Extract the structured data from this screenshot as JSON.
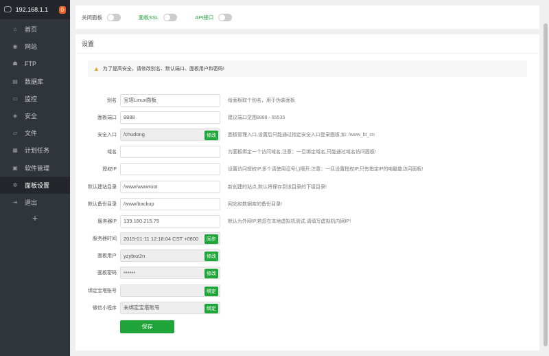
{
  "sidebar": {
    "host": "192.168.1.1",
    "badge": "0",
    "items": [
      {
        "label": "首页",
        "icon": "home-icon",
        "glyph": "⌂"
      },
      {
        "label": "网站",
        "icon": "globe-icon",
        "glyph": "◉"
      },
      {
        "label": "FTP",
        "icon": "ftp-icon",
        "glyph": "☗"
      },
      {
        "label": "数据库",
        "icon": "database-icon",
        "glyph": "▤"
      },
      {
        "label": "监控",
        "icon": "monitor-icon",
        "glyph": "▭"
      },
      {
        "label": "安全",
        "icon": "shield-icon",
        "glyph": "◈"
      },
      {
        "label": "文件",
        "icon": "folder-icon",
        "glyph": "▱"
      },
      {
        "label": "计划任务",
        "icon": "calendar-icon",
        "glyph": "▦"
      },
      {
        "label": "软件管理",
        "icon": "apps-icon",
        "glyph": "▣"
      },
      {
        "label": "面板设置",
        "icon": "gear-icon",
        "glyph": "✲"
      },
      {
        "label": "退出",
        "icon": "logout-icon",
        "glyph": "⇥"
      }
    ],
    "add": "+"
  },
  "toggles": [
    {
      "label": "关闭面板"
    },
    {
      "label": "面板SSL"
    },
    {
      "label": "API接口"
    }
  ],
  "settings": {
    "title": "设置",
    "warning": "为了提高安全，请修改别名、默认端口、面板用户和密码!",
    "rows": [
      {
        "label": "别名",
        "value": "宝塔Linux面板",
        "hint": "给面板取个别名，用于伪装面板"
      },
      {
        "label": "面板端口",
        "value": "8888",
        "hint": "建议端口范围8888 - 65535"
      },
      {
        "label": "安全入口",
        "value": "/chudong",
        "button": "修改",
        "hint": "面板管理入口,设置后只能通过指定安全入口登录面板,如: /www_bt_cn"
      },
      {
        "label": "域名",
        "value": "",
        "hint": "为面板绑定一个访问域名;注意：一旦绑定域名,只能通过域名访问面板!"
      },
      {
        "label": "授权IP",
        "value": "",
        "hint": "设置访问授权IP,多个请使用逗号(,)隔开;注意：一旦设置授权IP,只有指定IP的电脑能访问面板!"
      },
      {
        "label": "默认建站目录",
        "value": "/www/wwwroot",
        "hint": "新创建的站点,默认将保存到该目录的下级目录!"
      },
      {
        "label": "默认备份目录",
        "value": "/www/backup",
        "hint": "网站和数据库的备份目录!"
      },
      {
        "label": "服务器IP",
        "value": "139.180.215.75",
        "hint": "默认为外网IP,若您在本地虚拟机测试,请填写虚拟机内网IP!"
      },
      {
        "label": "服务器时间",
        "value": "2019-01-11 12:18:04 CST +0800",
        "button": "同步"
      },
      {
        "label": "面板用户",
        "value": "yzybxz2n",
        "button": "修改"
      },
      {
        "label": "面板密码",
        "value": "******",
        "button": "修改"
      },
      {
        "label": "绑定宝塔账号",
        "value": "",
        "button": "绑定"
      },
      {
        "label": "微信小程序",
        "value": "未绑定宝塔账号",
        "button": "绑定"
      }
    ],
    "save": "保存"
  }
}
